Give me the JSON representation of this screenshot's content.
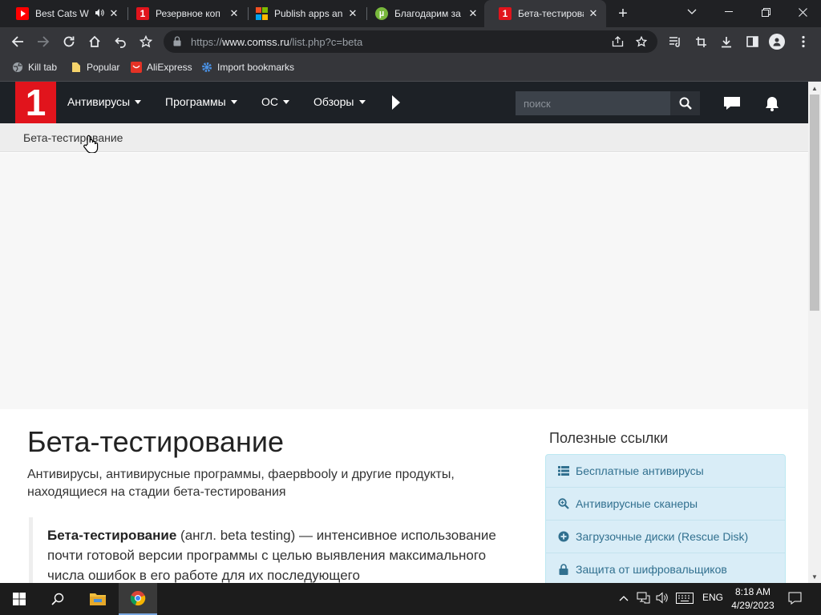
{
  "browser": {
    "tabs": [
      {
        "title": "Best Cats W",
        "favicon": "youtube-icon",
        "audio": true,
        "active": false
      },
      {
        "title": "Резервное коп",
        "favicon": "comss-icon",
        "active": false
      },
      {
        "title": "Publish apps an",
        "favicon": "microsoft-icon",
        "active": false
      },
      {
        "title": "Благодарим за",
        "favicon": "utorrent-icon",
        "active": false
      },
      {
        "title": "Бета-тестирова",
        "favicon": "comss-icon",
        "active": true
      }
    ],
    "url_prefix": "https://",
    "url_host": "www.comss.ru",
    "url_path": "/list.php?c=beta",
    "bookmarks": [
      {
        "label": "Kill tab",
        "icon": "globe-icon"
      },
      {
        "label": "Popular",
        "icon": "folder-icon"
      },
      {
        "label": "AliExpress",
        "icon": "aliexpress-icon"
      },
      {
        "label": "Import bookmarks",
        "icon": "gear-icon"
      }
    ]
  },
  "site": {
    "logo_text": "1",
    "nav": [
      {
        "label": "Антивирусы"
      },
      {
        "label": "Программы"
      },
      {
        "label": "ОС"
      },
      {
        "label": "Обзоры"
      }
    ],
    "search_placeholder": "поиск",
    "breadcrumb": "Бета-тестирование"
  },
  "main": {
    "title": "Бета-тестирование",
    "subtitle": "Антивирусы, антивирусные программы, фаервbooly и другие продукты, находящиеся на стадии бета-тестирования",
    "definition_term": "Бета-тестирование",
    "definition_text": " (англ. beta testing) — интенсивное использование почти готовой версии программы с целью выявления максимального числа ошибок в его работе для их последующего"
  },
  "sidebar": {
    "title": "Полезные ссылки",
    "links": [
      {
        "label": "Бесплатные антивирусы",
        "icon": "list-icon"
      },
      {
        "label": "Антивирусные сканеры",
        "icon": "search-plus-icon"
      },
      {
        "label": "Загрузочные диски (Rescue Disk)",
        "icon": "plus-circle-icon"
      },
      {
        "label": "Защита от шифровальщиков",
        "icon": "lock-icon"
      }
    ]
  },
  "taskbar": {
    "language": "ENG",
    "time": "8:18 AM",
    "date": "4/29/2023"
  },
  "colors": {
    "brand_red": "#e1141c",
    "navbar": "#1d2126",
    "link_panel": "#d9edf7",
    "link_text": "#31708f"
  }
}
